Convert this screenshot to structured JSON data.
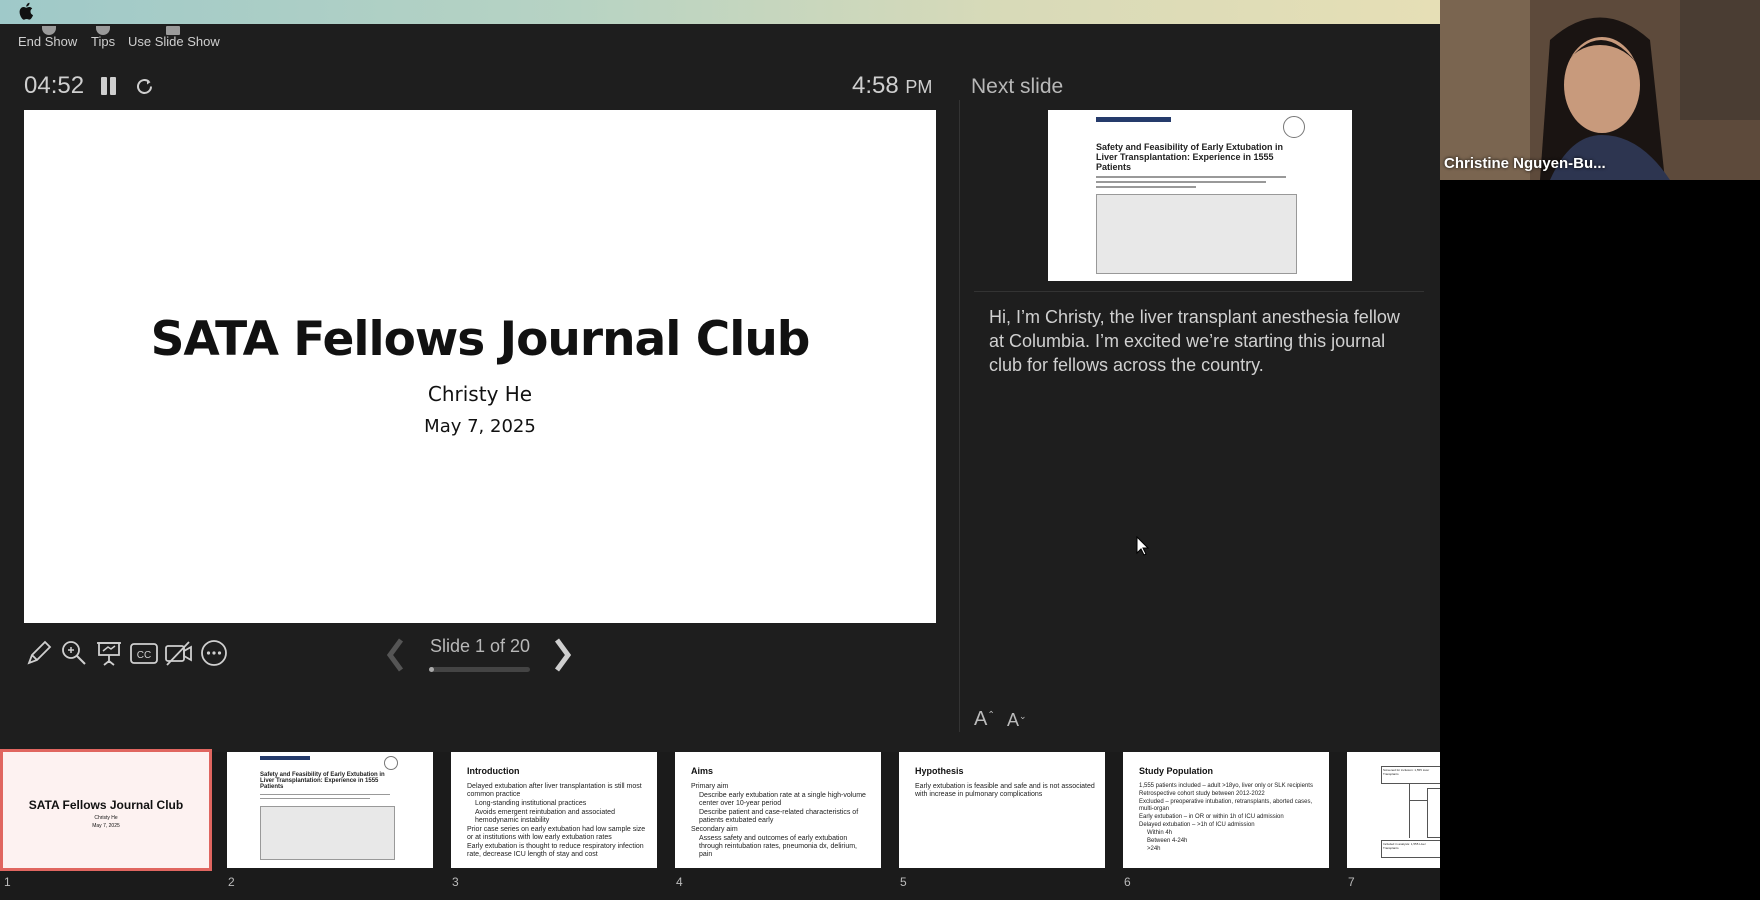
{
  "toolbar": {
    "items": [
      {
        "label": "End Show",
        "icon": "end-show-icon"
      },
      {
        "label": "Tips",
        "icon": "tips-icon"
      },
      {
        "label": "Use Slide Show",
        "icon": "slide-show-icon"
      }
    ]
  },
  "presenter": {
    "timer": "04:52",
    "clock": "4:58",
    "clock_ampm": "PM"
  },
  "current_slide": {
    "title": "SATA Fellows Journal Club",
    "author": "Christy He",
    "date": "May 7, 2025"
  },
  "navigation": {
    "counter": "Slide 1 of 20",
    "progress": 0.05
  },
  "next_slide": {
    "label": "Next slide",
    "paper_title": "Safety and Feasibility of Early Extubation in Liver Transplantation: Experience in 1555 Patients"
  },
  "notes": {
    "text": "Hi, I’m Christy, the liver transplant anesthesia fellow at Columbia. I’m excited we’re starting this journal club for fellows across the country."
  },
  "font_controls": {
    "increase": "A",
    "decrease": "A"
  },
  "video": {
    "participant_name": "Christine Nguyen-Bu..."
  },
  "thumbnails": [
    {
      "num": "1",
      "title": "SATA Fellows Journal Club",
      "sub1": "Christy He",
      "sub2": "May 7, 2025"
    },
    {
      "num": "2",
      "title": "Safety and Feasibility of Early Extubation in Liver Transplantation: Experience in 1555 Patients"
    },
    {
      "num": "3",
      "title": "Introduction",
      "bullets": [
        "Delayed extubation after liver transplantation is still most common practice",
        "Long-standing institutional practices",
        "Avoids emergent reintubation and associated hemodynamic instability",
        "Prior case series on early extubation had low sample size or at institutions with low early extubation rates",
        "Early extubation is thought to reduce respiratory infection rate, decrease ICU length of stay and cost"
      ]
    },
    {
      "num": "4",
      "title": "Aims",
      "bullets": [
        "Primary aim",
        "Describe early extubation rate at a single high-volume center over 10-year period",
        "Describe patient and case-related characteristics of patients extubated early",
        "Secondary aim",
        "Assess safety and outcomes of early extubation through reintubation rates, pneumonia dx, delirium, pain"
      ]
    },
    {
      "num": "5",
      "title": "Hypothesis",
      "bullets": [
        "Early extubation is feasible and safe and is not associated with increase in pulmonary complications"
      ]
    },
    {
      "num": "6",
      "title": "Study Population",
      "bullets": [
        "1,555 patients included – adult >18yo, liver only or SLK recipients",
        "Retrospective cohort study between 2012-2022",
        "Excluded – preoperative intubation, retransplants, aborted cases, multi-organ",
        "Early extubation – in OR or within 1h of ICU admission",
        "Delayed extubation – >1h of ICU admission",
        "Within 4h",
        "Between 4-24h",
        ">24h"
      ]
    },
    {
      "num": "7",
      "box1": "Screened for inclusion: 1,555 Liver Transplants",
      "box2": "Included in analysis: 1,555 Liver Transplants"
    }
  ]
}
